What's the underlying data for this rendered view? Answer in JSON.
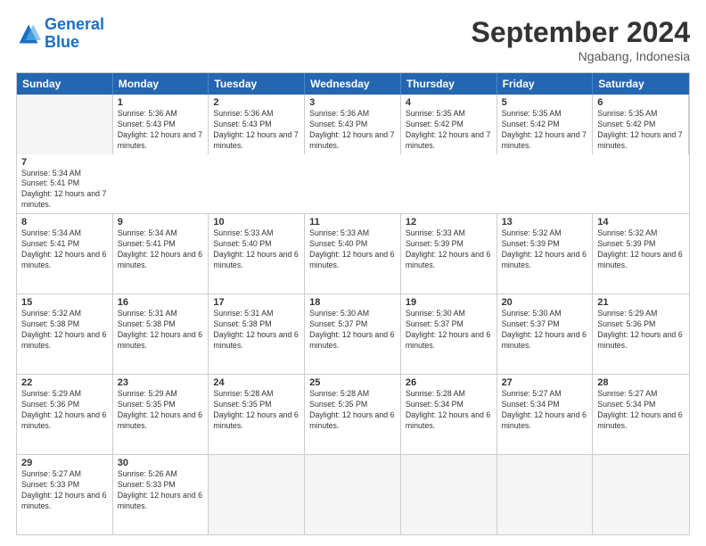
{
  "logo": {
    "line1": "General",
    "line2": "Blue"
  },
  "title": "September 2024",
  "location": "Ngabang, Indonesia",
  "days": [
    "Sunday",
    "Monday",
    "Tuesday",
    "Wednesday",
    "Thursday",
    "Friday",
    "Saturday"
  ],
  "rows": [
    [
      {
        "day": "",
        "empty": true
      },
      {
        "day": "1",
        "rise": "5:36 AM",
        "set": "5:43 PM",
        "daylight": "12 hours and 7 minutes."
      },
      {
        "day": "2",
        "rise": "5:36 AM",
        "set": "5:43 PM",
        "daylight": "12 hours and 7 minutes."
      },
      {
        "day": "3",
        "rise": "5:36 AM",
        "set": "5:43 PM",
        "daylight": "12 hours and 7 minutes."
      },
      {
        "day": "4",
        "rise": "5:35 AM",
        "set": "5:42 PM",
        "daylight": "12 hours and 7 minutes."
      },
      {
        "day": "5",
        "rise": "5:35 AM",
        "set": "5:42 PM",
        "daylight": "12 hours and 7 minutes."
      },
      {
        "day": "6",
        "rise": "5:35 AM",
        "set": "5:42 PM",
        "daylight": "12 hours and 7 minutes."
      },
      {
        "day": "7",
        "rise": "5:34 AM",
        "set": "5:41 PM",
        "daylight": "12 hours and 7 minutes."
      }
    ],
    [
      {
        "day": "8",
        "rise": "5:34 AM",
        "set": "5:41 PM",
        "daylight": "12 hours and 6 minutes."
      },
      {
        "day": "9",
        "rise": "5:34 AM",
        "set": "5:41 PM",
        "daylight": "12 hours and 6 minutes."
      },
      {
        "day": "10",
        "rise": "5:33 AM",
        "set": "5:40 PM",
        "daylight": "12 hours and 6 minutes."
      },
      {
        "day": "11",
        "rise": "5:33 AM",
        "set": "5:40 PM",
        "daylight": "12 hours and 6 minutes."
      },
      {
        "day": "12",
        "rise": "5:33 AM",
        "set": "5:39 PM",
        "daylight": "12 hours and 6 minutes."
      },
      {
        "day": "13",
        "rise": "5:32 AM",
        "set": "5:39 PM",
        "daylight": "12 hours and 6 minutes."
      },
      {
        "day": "14",
        "rise": "5:32 AM",
        "set": "5:39 PM",
        "daylight": "12 hours and 6 minutes."
      }
    ],
    [
      {
        "day": "15",
        "rise": "5:32 AM",
        "set": "5:38 PM",
        "daylight": "12 hours and 6 minutes."
      },
      {
        "day": "16",
        "rise": "5:31 AM",
        "set": "5:38 PM",
        "daylight": "12 hours and 6 minutes."
      },
      {
        "day": "17",
        "rise": "5:31 AM",
        "set": "5:38 PM",
        "daylight": "12 hours and 6 minutes."
      },
      {
        "day": "18",
        "rise": "5:30 AM",
        "set": "5:37 PM",
        "daylight": "12 hours and 6 minutes."
      },
      {
        "day": "19",
        "rise": "5:30 AM",
        "set": "5:37 PM",
        "daylight": "12 hours and 6 minutes."
      },
      {
        "day": "20",
        "rise": "5:30 AM",
        "set": "5:37 PM",
        "daylight": "12 hours and 6 minutes."
      },
      {
        "day": "21",
        "rise": "5:29 AM",
        "set": "5:36 PM",
        "daylight": "12 hours and 6 minutes."
      }
    ],
    [
      {
        "day": "22",
        "rise": "5:29 AM",
        "set": "5:36 PM",
        "daylight": "12 hours and 6 minutes."
      },
      {
        "day": "23",
        "rise": "5:29 AM",
        "set": "5:35 PM",
        "daylight": "12 hours and 6 minutes."
      },
      {
        "day": "24",
        "rise": "5:28 AM",
        "set": "5:35 PM",
        "daylight": "12 hours and 6 minutes."
      },
      {
        "day": "25",
        "rise": "5:28 AM",
        "set": "5:35 PM",
        "daylight": "12 hours and 6 minutes."
      },
      {
        "day": "26",
        "rise": "5:28 AM",
        "set": "5:34 PM",
        "daylight": "12 hours and 6 minutes."
      },
      {
        "day": "27",
        "rise": "5:27 AM",
        "set": "5:34 PM",
        "daylight": "12 hours and 6 minutes."
      },
      {
        "day": "28",
        "rise": "5:27 AM",
        "set": "5:34 PM",
        "daylight": "12 hours and 6 minutes."
      }
    ],
    [
      {
        "day": "29",
        "rise": "5:27 AM",
        "set": "5:33 PM",
        "daylight": "12 hours and 6 minutes."
      },
      {
        "day": "30",
        "rise": "5:26 AM",
        "set": "5:33 PM",
        "daylight": "12 hours and 6 minutes."
      },
      {
        "day": "",
        "empty": true
      },
      {
        "day": "",
        "empty": true
      },
      {
        "day": "",
        "empty": true
      },
      {
        "day": "",
        "empty": true
      },
      {
        "day": "",
        "empty": true
      }
    ]
  ]
}
